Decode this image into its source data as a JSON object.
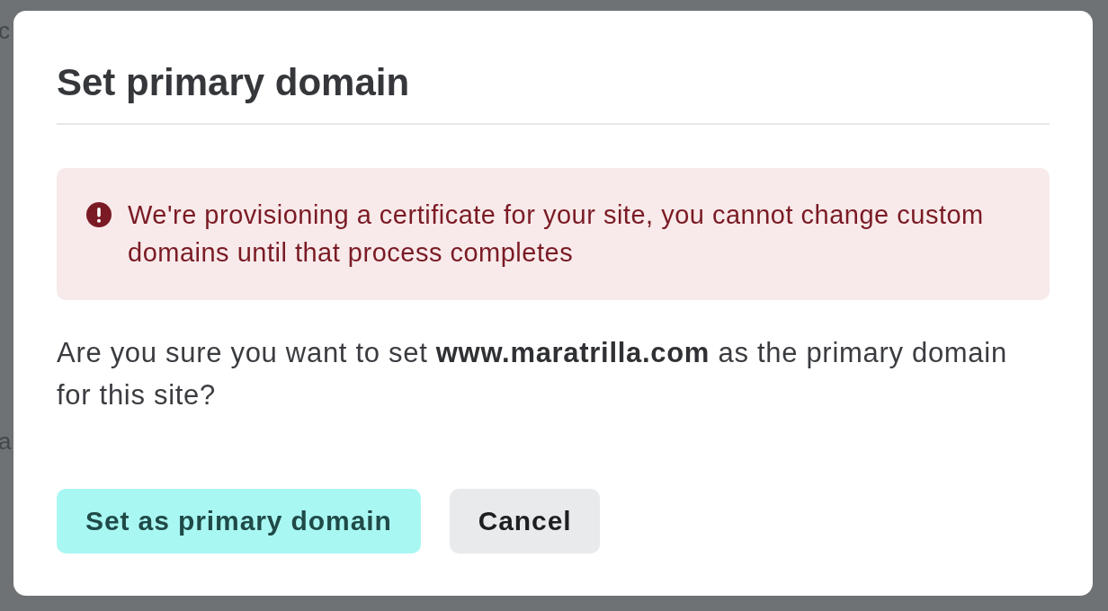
{
  "background_text": [
    "c",
    "a"
  ],
  "dialog": {
    "title": "Set primary domain",
    "alert": {
      "kind": "error",
      "message": "We're provisioning a certificate for your site, you cannot change custom domains until that process completes"
    },
    "message": "Are you sure you want to set **www.maratrilla.com** as the primary domain for this site?",
    "buttons": [
      {
        "label": "Set as primary domain",
        "kind": "primary"
      },
      {
        "label": "Cancel",
        "kind": "secondary"
      }
    ]
  }
}
